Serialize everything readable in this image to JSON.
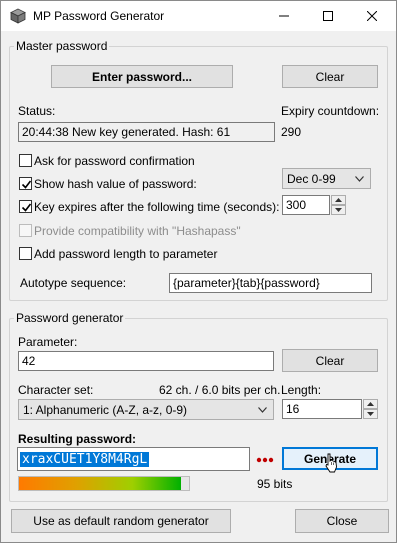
{
  "window": {
    "title": "MP Password Generator",
    "minimize": "minimize",
    "maximize": "maximize",
    "close": "close"
  },
  "master": {
    "group_title": "Master password",
    "enter_button": "Enter password...",
    "clear_button": "Clear",
    "status_label": "Status:",
    "status_value": "20:44:38 New key generated. Hash: 61",
    "expiry_label": "Expiry countdown:",
    "expiry_value": "290",
    "ask_confirm": {
      "label": "Ask for password confirmation",
      "checked": false
    },
    "show_hash": {
      "label": "Show hash value of password:",
      "checked": true
    },
    "hash_format": "Dec 0-99",
    "key_expires": {
      "label": "Key expires after the following time (seconds):",
      "checked": true
    },
    "expire_seconds": "300",
    "hashapass": {
      "label": "Provide compatibility with \"Hashapass\"",
      "checked": false,
      "disabled": true
    },
    "add_length": {
      "label": "Add password length to parameter",
      "checked": false
    },
    "autotype_label": "Autotype sequence:",
    "autotype_value": "{parameter}{tab}{password}"
  },
  "generator": {
    "group_title": "Password generator",
    "parameter_label": "Parameter:",
    "parameter_value": "42",
    "clear_button": "Clear",
    "charset_label": "Character set:",
    "charset_info": "62 ch. / 6.0 bits per ch.",
    "charset_value": "1: Alphanumeric (A-Z, a-z, 0-9)",
    "length_label": "Length:",
    "length_value": "16",
    "result_label": "Resulting password:",
    "result_value": "xraxCUET1Y8M4RgL",
    "generate_button": "Generate",
    "strength_bits": "95 bits",
    "strength_fraction": 0.95
  },
  "footer": {
    "default_button": "Use as default random generator",
    "close_button": "Close"
  },
  "icons": {
    "app": "app-icon",
    "check": "check-icon",
    "chevron": "chevron-down-icon",
    "spin_up": "spin-up-icon",
    "spin_down": "spin-down-icon",
    "dots": "more-dots-icon",
    "cursor": "mouse-cursor-icon"
  },
  "colors": {
    "accent": "#0078d7",
    "dots": "#c00000",
    "strength_start": "#ff8000",
    "strength_end": "#00b000"
  }
}
